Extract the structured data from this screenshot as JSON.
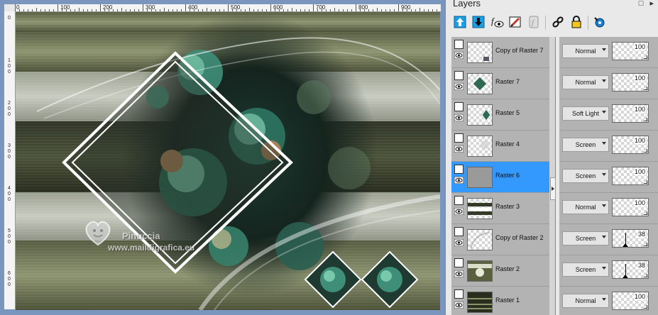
{
  "canvas": {
    "ruler_top_labels": [
      "0",
      "100",
      "200",
      "300",
      "400",
      "500",
      "600",
      "700",
      "800",
      "900"
    ],
    "ruler_left_labels": [
      "0",
      "1",
      "0",
      "0",
      "2",
      "0",
      "0",
      "3",
      "0",
      "0",
      "4",
      "0",
      "0",
      "5",
      "0",
      "0",
      "6",
      "0",
      "0"
    ],
    "watermark_name": "Pinuccia",
    "watermark_url": "www.maildigrafica.eu"
  },
  "layers_panel": {
    "title": "Layers",
    "window_buttons": "□ ▸",
    "toolbar_icons": [
      "move-layer-up-icon",
      "move-layer-down-icon",
      "visibility-icon",
      "edit-layer-icon",
      "mask-icon",
      "link-icon",
      "lock-icon",
      "properties-icon"
    ],
    "layers": [
      {
        "name": "Copy of Raster 7",
        "blend_mode": "Normal",
        "opacity": "100",
        "selected": false
      },
      {
        "name": "Raster 7",
        "blend_mode": "Normal",
        "opacity": "100",
        "selected": false
      },
      {
        "name": "Raster 5",
        "blend_mode": "Soft Light",
        "opacity": "100",
        "selected": false
      },
      {
        "name": "Raster 4",
        "blend_mode": "Screen",
        "opacity": "100",
        "selected": false
      },
      {
        "name": "Raster 6",
        "blend_mode": "Screen",
        "opacity": "100",
        "selected": true
      },
      {
        "name": "Raster 3",
        "blend_mode": "Normal",
        "opacity": "100",
        "selected": false
      },
      {
        "name": "Copy of Raster 2",
        "blend_mode": "Screen",
        "opacity": "38",
        "selected": false
      },
      {
        "name": "Raster 2",
        "blend_mode": "Screen",
        "opacity": "38",
        "selected": false
      },
      {
        "name": "Raster 1",
        "blend_mode": "Normal",
        "opacity": "100",
        "selected": false
      }
    ],
    "colors": {
      "selection": "#3399ff",
      "list_bg": "#b3b3b3",
      "canvas_frame": "#7a96bf"
    }
  }
}
